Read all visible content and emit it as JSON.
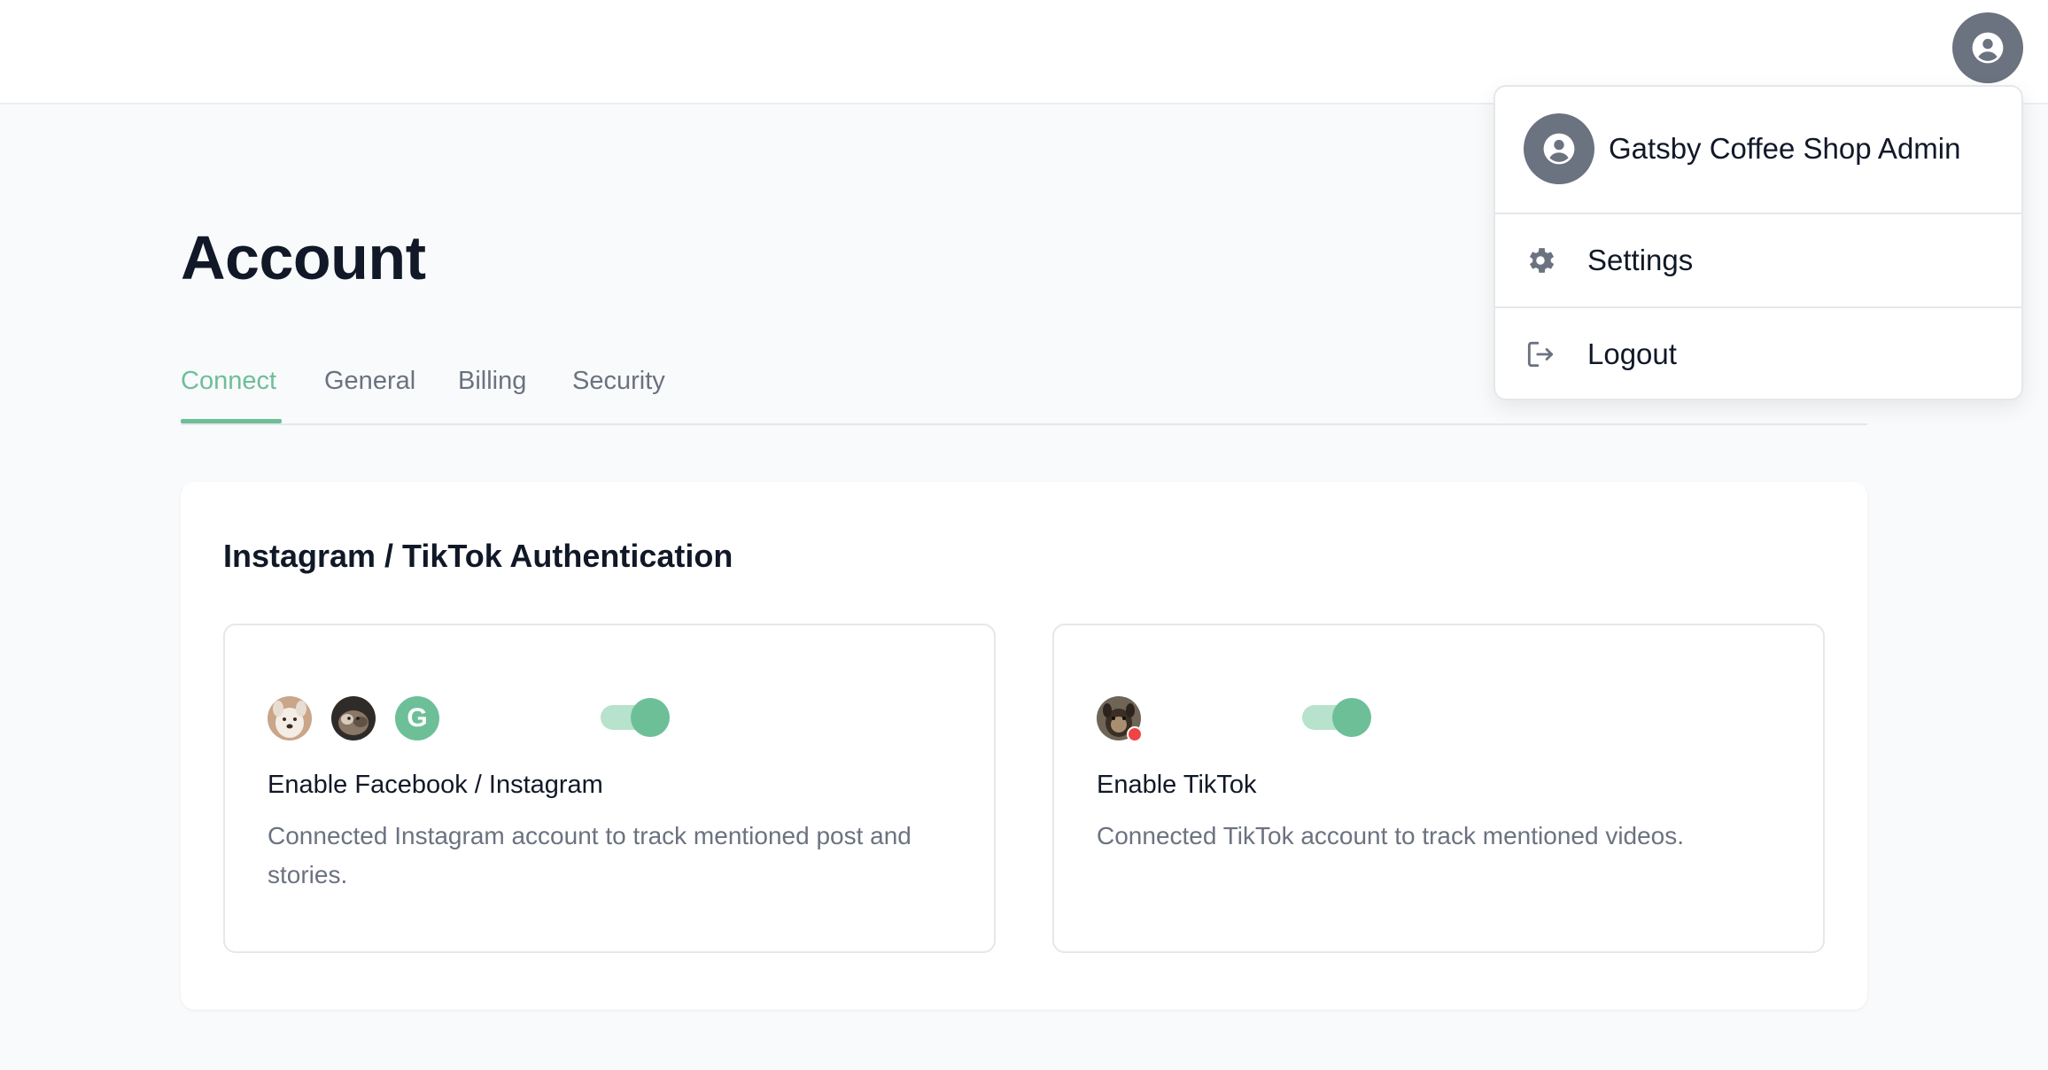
{
  "header": {
    "avatar_icon": "user-circle-icon"
  },
  "page": {
    "title": "Account"
  },
  "tabs": [
    {
      "label": "Connect",
      "active": true
    },
    {
      "label": "General",
      "active": false
    },
    {
      "label": "Billing",
      "active": false
    },
    {
      "label": "Security",
      "active": false
    }
  ],
  "section": {
    "title": "Instagram / TikTok Authentication",
    "cards": [
      {
        "title": "Enable Facebook / Instagram",
        "description": "Connected Instagram account to track mentioned post and stories.",
        "enabled": true,
        "avatars": [
          "dog-photo-avatar",
          "cat-photo-avatar",
          "google-avatar"
        ],
        "google_letter": "G"
      },
      {
        "title": "Enable TikTok",
        "description": "Connected TikTok account to track mentioned videos.",
        "enabled": true,
        "avatars": [
          "dog-photo-avatar"
        ]
      }
    ]
  },
  "dropdown": {
    "user_name": "Gatsby Coffee Shop Admin",
    "items": [
      {
        "label": "Settings",
        "icon": "gear-icon"
      },
      {
        "label": "Logout",
        "icon": "logout-icon"
      }
    ]
  },
  "colors": {
    "accent": "#6dbf98",
    "accent_light": "#b7e2cc",
    "avatar_bg": "#6b7280",
    "status_dot": "#ef4444"
  }
}
